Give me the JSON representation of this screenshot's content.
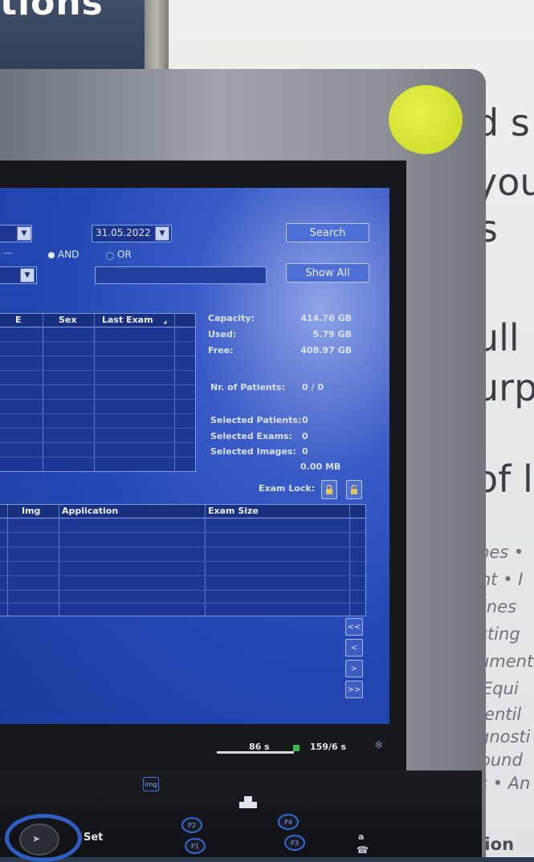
{
  "background": {
    "wall_text": "tions",
    "poster_lines": [
      "d s",
      "you",
      "s",
      "ull",
      "urp",
      "of l"
    ],
    "poster_small_lines": [
      "pes •",
      "nt • I",
      "ines",
      "sting",
      "ument",
      "Equi",
      "Ventil",
      "gnosti",
      "ound",
      "s • An",
      "uction"
    ]
  },
  "search": {
    "date_value": "31.05.2022",
    "and_label": "AND",
    "or_label": "OR",
    "search_button": "Search",
    "show_all_button": "Show All",
    "dash_label": "—"
  },
  "patient_table": {
    "headers": [
      "E",
      "Sex",
      "Last Exam"
    ],
    "rows": 9
  },
  "storage": {
    "capacity_label": "Capacity:",
    "capacity_value": "414.76 GB",
    "used_label": "Used:",
    "used_value": "5.79 GB",
    "free_label": "Free:",
    "free_value": "408.97 GB",
    "patients_label": "Nr. of Patients:",
    "patients_value": "0 / 0",
    "selected_patients_label": "Selected Patients:",
    "selected_patients_value": "0",
    "selected_exams_label": "Selected Exams:",
    "selected_exams_value": "0",
    "selected_images_label": "Selected Images:",
    "selected_images_value": "0",
    "selected_size": "0.00 MB",
    "exam_lock_label": "Exam Lock:"
  },
  "exam_table": {
    "headers": [
      "Img",
      "Application",
      "Exam Size"
    ],
    "rows": 6
  },
  "nav_buttons": [
    "<<",
    "<",
    ">",
    ">>"
  ],
  "status_bar": {
    "timer_left": "86 s",
    "timer_right": "159/6 s"
  },
  "controls": {
    "img_key": "img",
    "set_label": "Set",
    "p1": "P1",
    "p2": "P2",
    "p3": "P3",
    "p4": "P4",
    "a_label": "a"
  },
  "colors": {
    "screen_blue": "#2449b5",
    "button_blue": "#4d6fd6",
    "sticker": "#d4e334"
  }
}
